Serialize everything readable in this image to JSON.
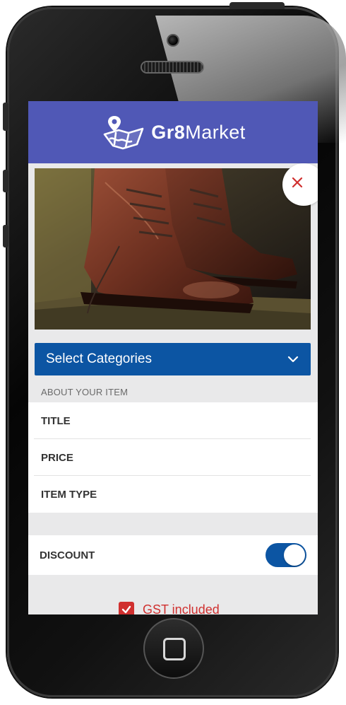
{
  "app": {
    "brand_bold": "Gr8",
    "brand_rest": "Market"
  },
  "form": {
    "category_select": "Select Categories",
    "section_title": "ABOUT YOUR ITEM",
    "fields": [
      {
        "label": "TITLE"
      },
      {
        "label": "PRICE"
      },
      {
        "label": "ITEM TYPE"
      }
    ],
    "discount_label": "DISCOUNT",
    "discount_enabled": true,
    "gst_label": "GST included",
    "gst_checked": true
  },
  "colors": {
    "header": "#5058b6",
    "accent": "#0c55a3",
    "danger": "#d0302f"
  },
  "icons": {
    "logo": "map-pin-logo-icon",
    "remove_photo": "close-icon",
    "category_dropdown": "chevron-down-icon",
    "gst_checkbox": "checkmark-icon"
  }
}
